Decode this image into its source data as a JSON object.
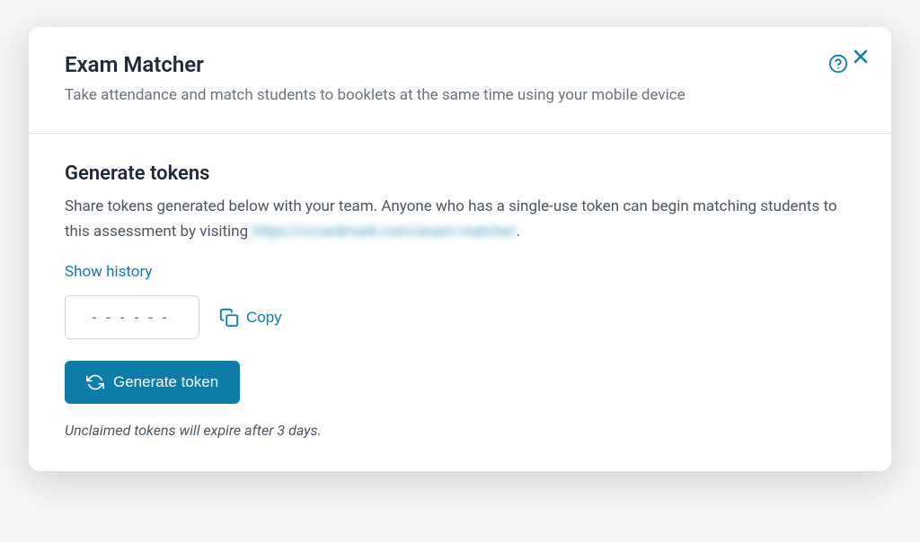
{
  "modal": {
    "title": "Exam Matcher",
    "subtitle": "Take attendance and match students to booklets at the same time using your mobile device"
  },
  "section": {
    "title": "Generate tokens",
    "description_prefix": "Share tokens generated below with your team. Anyone who has a single-use token can begin matching students to this assessment by visiting ",
    "description_link": "https://crowdmark.com/exam-matcher",
    "description_suffix": "."
  },
  "actions": {
    "show_history_label": "Show history",
    "token_placeholder": "------",
    "copy_label": "Copy",
    "generate_label": "Generate token"
  },
  "footer": {
    "expiry_note": "Unclaimed tokens will expire after 3 days."
  }
}
